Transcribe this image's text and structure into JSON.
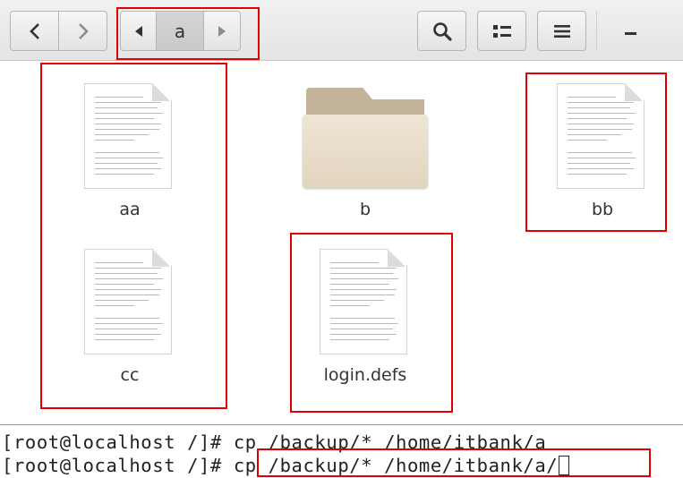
{
  "header": {
    "back_icon": "chevron-left-icon",
    "forward_icon": "chevron-right-icon",
    "path_prev_icon": "triangle-left-icon",
    "path_next_icon": "triangle-right-icon",
    "path_label": "a",
    "search_icon": "search-icon",
    "view_toggle_icon": "list-view-icon",
    "menu_icon": "hamburger-menu-icon",
    "minimize_icon": "minimize-icon"
  },
  "files": [
    {
      "name": "aa",
      "type": "document"
    },
    {
      "name": "b",
      "type": "folder"
    },
    {
      "name": "bb",
      "type": "document"
    },
    {
      "name": "cc",
      "type": "document"
    },
    {
      "name": "login.defs",
      "type": "document"
    }
  ],
  "terminal": {
    "lines": [
      "[root@localhost /]# cp /backup/* /home/itbank/a",
      "[root@localhost /]# cp /backup/* /home/itbank/a/"
    ]
  },
  "annotation_color": "#e00000"
}
